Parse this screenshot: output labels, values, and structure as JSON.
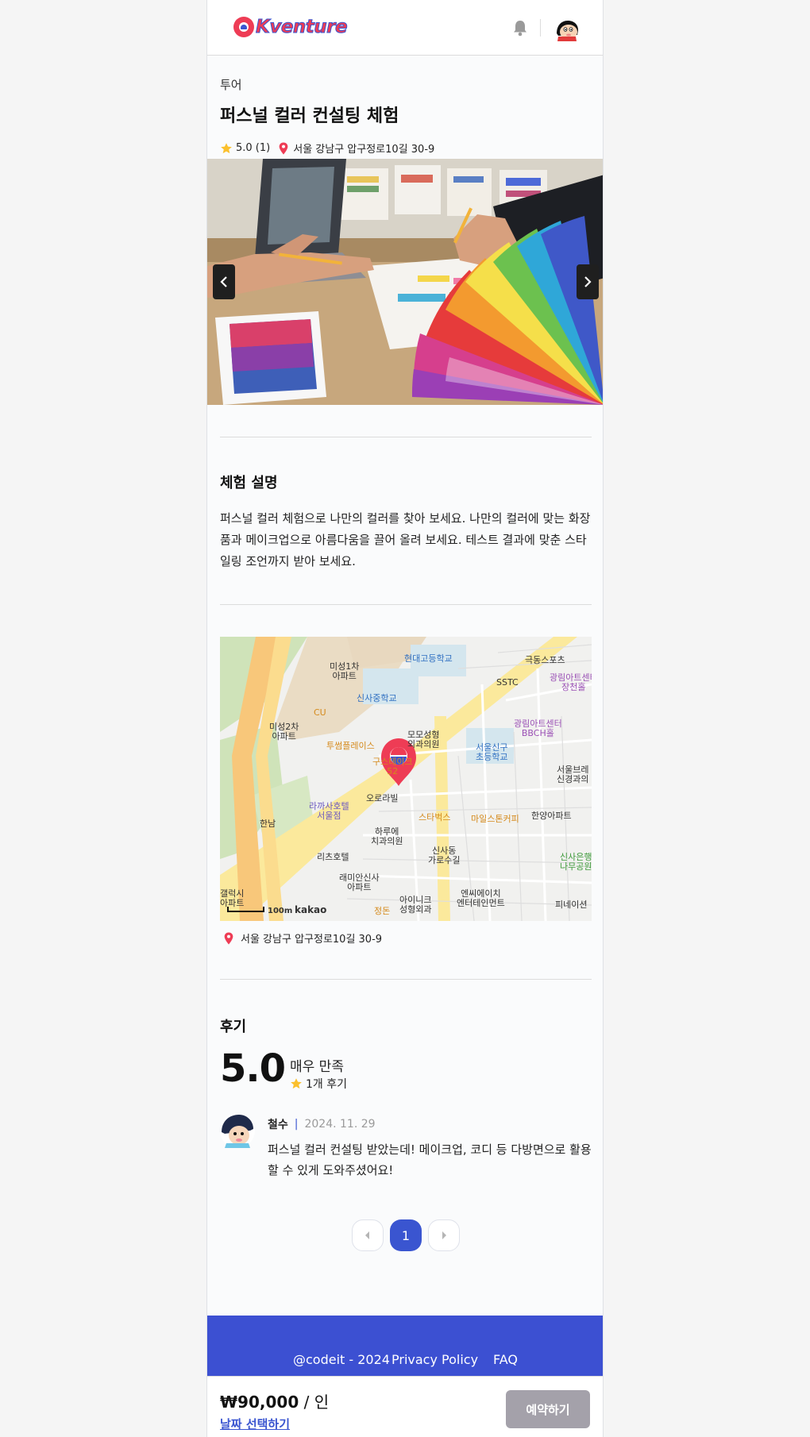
{
  "header": {
    "logo_text": "Kventure",
    "bell_icon": "bell-icon",
    "avatar_icon": "user-avatar"
  },
  "activity": {
    "category": "투어",
    "title": "퍼스널 컬러 컨설팅 체험",
    "rating": "5.0 (1)",
    "address": "서울 강남구 압구정로10길 30-9"
  },
  "description": {
    "heading": "체험 설명",
    "lines": [
      "퍼스널 컬러 체험으로 나만의 컬러를 찾아 보세요. 나만의 컬러에 맞는 화장",
      "품과 메이크업으로 아름다움을 끌어 올려 보세요. 테스트 결과에 맞춘 스타",
      "일링 조언까지 받아 보세요."
    ]
  },
  "map": {
    "labels": {
      "l1": "미성1차\n아파트",
      "l2": "현대고등학교",
      "l3": "극동스포츠",
      "l4": "SSTC",
      "l5": "광림아트센터\n장천홀",
      "l6": "신사중학교",
      "l7": "CU",
      "l8": "미성2차\n아파트",
      "l9": "광림아트센터\nBBCH홀",
      "l10": "모모성형\n외과의원",
      "l11": "서울신구\n초등학교",
      "l12": "투썸플레이스",
      "l13": "구스테이크\n52",
      "l14": "서울브레\n신경과의",
      "l15": "라까사호텔\n서울점",
      "l16": "오로라빌",
      "l17": "스타벅스",
      "l18": "마일스톤커피",
      "l19": "한양아파트",
      "l20": "한남",
      "l21": "하루에\n치과의원",
      "l22": "신사동\n가로수길",
      "l23": "리츠호텔",
      "l24": "신사은행\n나무공원",
      "l25": "래미안신사\n아파트",
      "l26": "엔씨에이치\n엔터테인먼트",
      "l27": "아이니크\n성형외과",
      "l28": "정돈",
      "l29": "갤럭시\n아파트",
      "l30": "피네이션"
    },
    "scale": "100m",
    "brand": "kakao"
  },
  "location_address": "서울 강남구 압구정로10길 30-9",
  "reviews": {
    "heading": "후기",
    "score": "5.0",
    "score_label": "매우 만족",
    "count": "1개 후기",
    "items": [
      {
        "name": "철수",
        "separator": "|",
        "date": "2024. 11. 29",
        "body_lines": [
          "퍼스널 컬러 컨설팅 받았는데! 메이크업, 코디 등 다방면으로 활용",
          "할 수 있게 도와주셨어요!"
        ]
      }
    ]
  },
  "pagination": {
    "current": "1"
  },
  "footer": {
    "copyright": "@codeit - 2024",
    "privacy": "Privacy Policy",
    "faq": "FAQ"
  },
  "booking": {
    "price": "₩90,000",
    "unit": " / 인",
    "pick_date": "날짜 선택하기",
    "book_button": "예약하기"
  },
  "colors": {
    "brand_red": "#ee3c55",
    "brand_blue": "#3a55d0",
    "footer_bg": "#3c50d2",
    "star": "#fbc02d",
    "disabled_button": "#a4a1aa"
  }
}
